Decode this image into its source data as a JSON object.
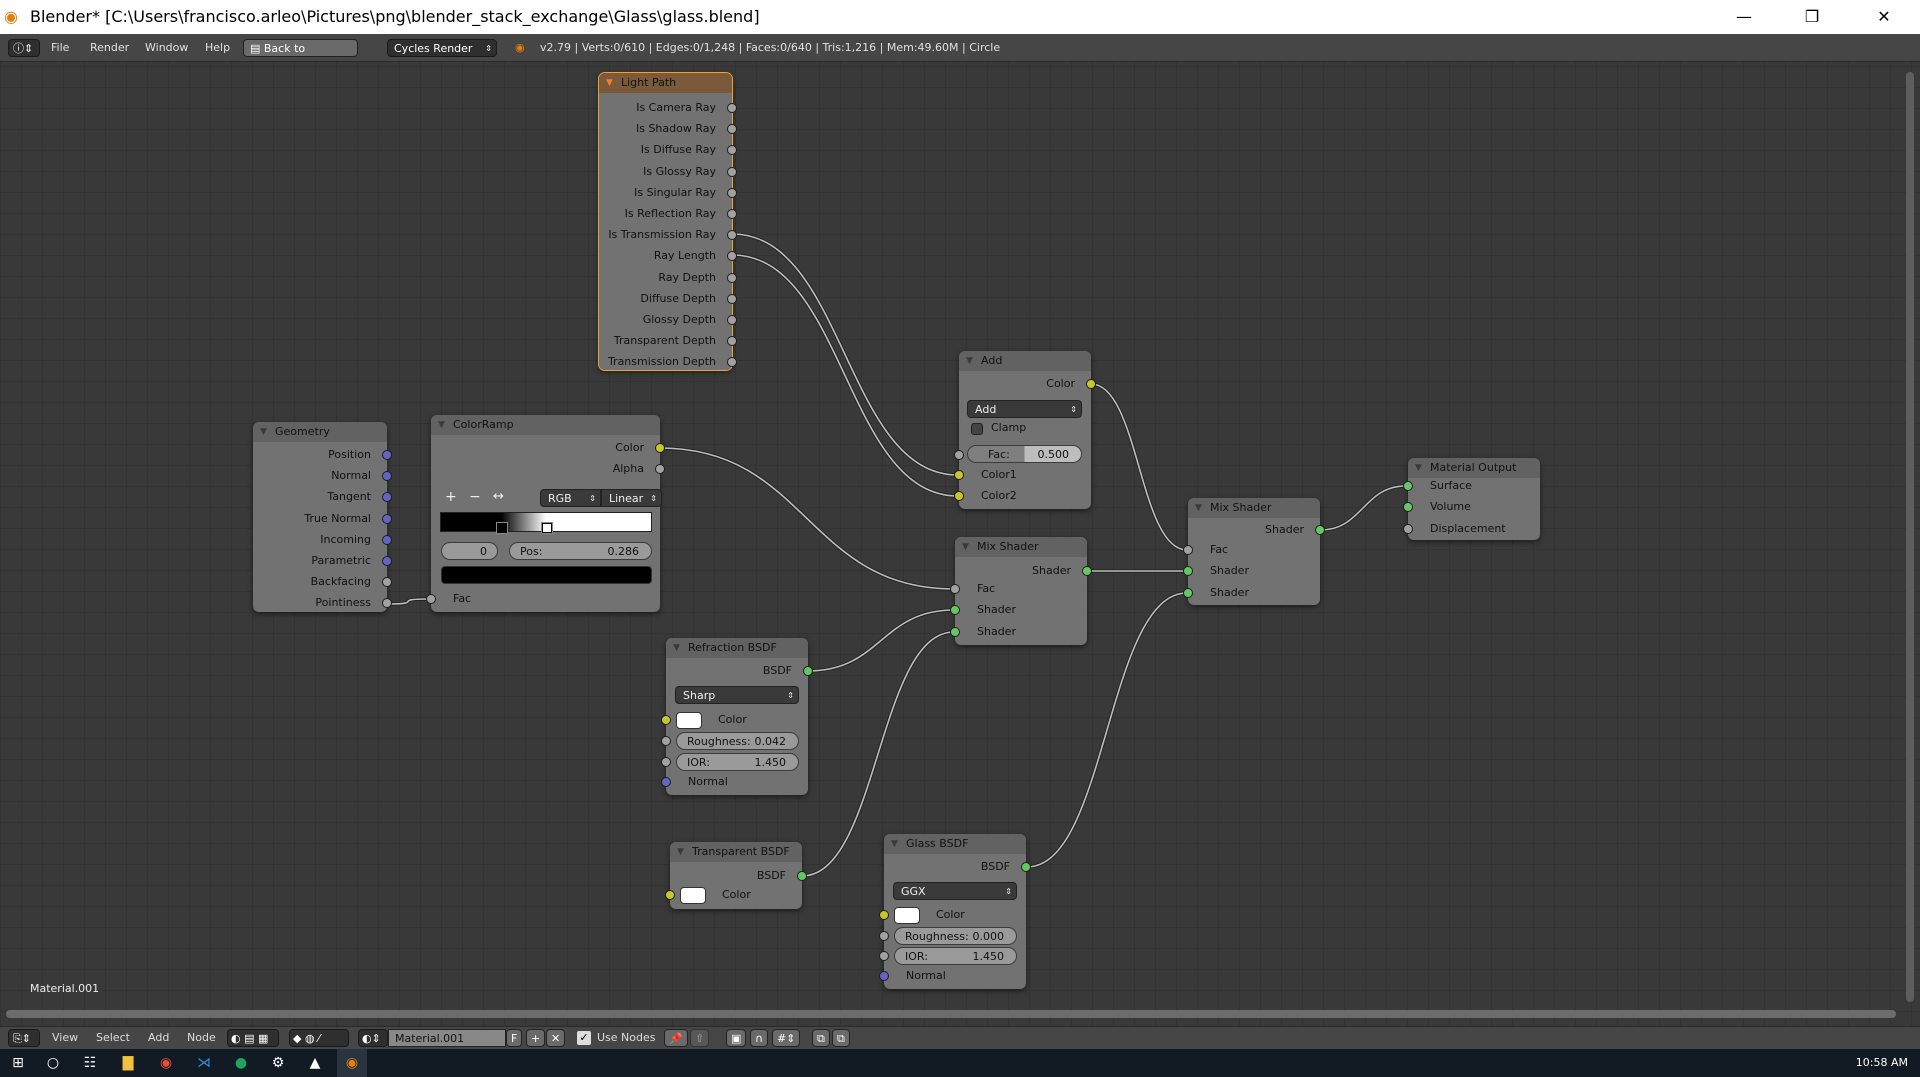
{
  "window": {
    "title": "Blender* [C:\\Users\\francisco.arleo\\Pictures\\png\\blender_stack_exchange\\Glass\\glass.blend]",
    "minimize": "—",
    "restore": "❐",
    "close": "✕"
  },
  "info_header": {
    "menus": [
      "File",
      "Render",
      "Window",
      "Help"
    ],
    "back_button": "Back to Previous",
    "engine": "Cycles Render",
    "stats": "v2.79 | Verts:0/610 | Edges:0/1,248 | Faces:0/640 | Tris:1,216 | Mem:49.60M | Circle"
  },
  "nodes": {
    "light_path": {
      "title": "Light Path",
      "outputs": [
        "Is Camera Ray",
        "Is Shadow Ray",
        "Is Diffuse Ray",
        "Is Glossy Ray",
        "Is Singular Ray",
        "Is Reflection Ray",
        "Is Transmission Ray",
        "Ray Length",
        "Ray Depth",
        "Diffuse Depth",
        "Glossy Depth",
        "Transparent Depth",
        "Transmission Depth"
      ]
    },
    "geometry": {
      "title": "Geometry",
      "outputs": [
        "Position",
        "Normal",
        "Tangent",
        "True Normal",
        "Incoming",
        "Parametric",
        "Backfacing",
        "Pointiness"
      ]
    },
    "colorramp": {
      "title": "ColorRamp",
      "outputs": [
        "Color",
        "Alpha"
      ],
      "add": "+",
      "remove": "−",
      "flip": "↔",
      "color_mode": "RGB",
      "interpolation": "Linear",
      "stop_index": "0",
      "pos_label": "Pos:",
      "pos_value": "0.286",
      "stop_positions": [
        0.286,
        0.5
      ],
      "input": "Fac"
    },
    "add": {
      "title": "Add",
      "output": "Color",
      "blend_type": "Add",
      "clamp_label": "Clamp",
      "clamp": false,
      "fac_label": "Fac:",
      "fac_value": "0.500",
      "fac": 0.5,
      "inputs": [
        "Color1",
        "Color2"
      ]
    },
    "mix_shader_1": {
      "title": "Mix Shader",
      "output": "Shader",
      "inputs": [
        "Fac",
        "Shader",
        "Shader"
      ]
    },
    "mix_shader_2": {
      "title": "Mix Shader",
      "output": "Shader",
      "inputs": [
        "Fac",
        "Shader",
        "Shader"
      ]
    },
    "material_output": {
      "title": "Material Output",
      "inputs": [
        "Surface",
        "Volume",
        "Displacement"
      ]
    },
    "refraction": {
      "title": "Refraction BSDF",
      "output": "BSDF",
      "distribution": "Sharp",
      "color_label": "Color",
      "roughness_label": "Roughness:",
      "roughness": "0.042",
      "ior_label": "IOR:",
      "ior": "1.450",
      "normal": "Normal"
    },
    "transparent": {
      "title": "Transparent BSDF",
      "output": "BSDF",
      "color_label": "Color"
    },
    "glass": {
      "title": "Glass BSDF",
      "output": "BSDF",
      "distribution": "GGX",
      "color_label": "Color",
      "roughness_label": "Roughness:",
      "roughness": "0.000",
      "ior_label": "IOR:",
      "ior": "1.450",
      "normal": "Normal"
    }
  },
  "material_label": "Material.001",
  "node_header": {
    "menus": [
      "View",
      "Select",
      "Add",
      "Node"
    ],
    "material": "Material.001",
    "fake_user": "F",
    "new": "+",
    "unlink": "✕",
    "use_nodes_label": "Use Nodes",
    "use_nodes": true
  },
  "taskbar": {
    "time": "10:58 AM"
  },
  "colors": {
    "socket_float": "#a1a1a1",
    "socket_color": "#c7c729",
    "socket_shader": "#63c763",
    "socket_vector": "#6363c7",
    "active_outline": "#f0a030"
  }
}
